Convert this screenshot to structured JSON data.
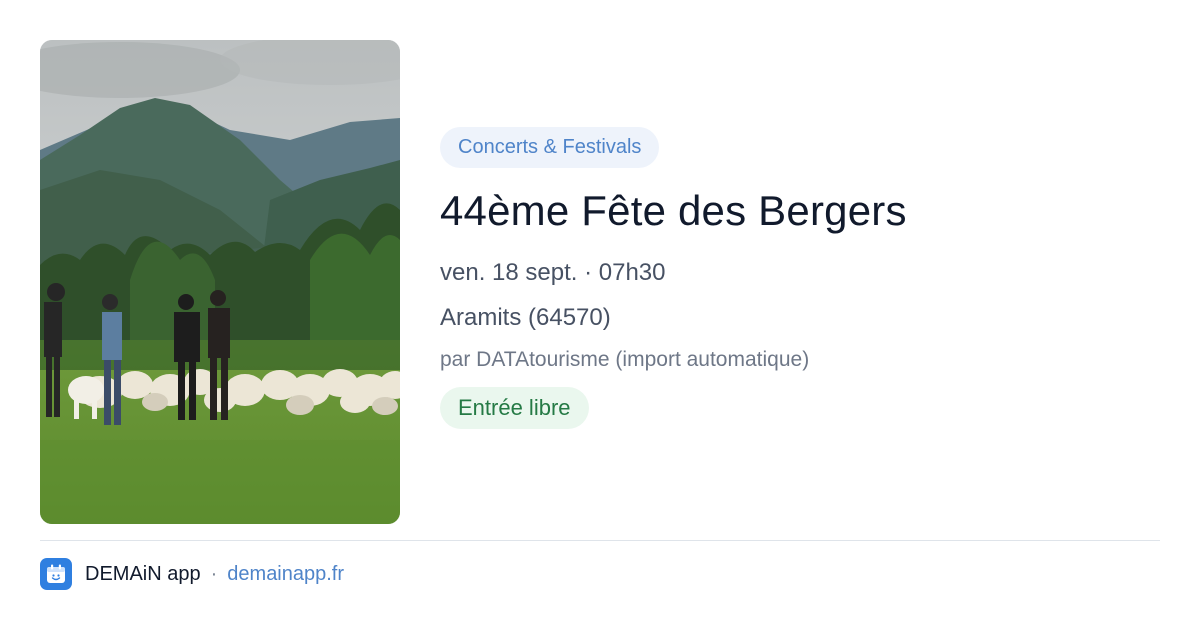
{
  "event": {
    "image_alt": "Bergers et troupeau de moutons dans une prairie au pied des montagnes",
    "category": "Concerts & Festivals",
    "title": "44ème Fête des Bergers",
    "datetime": "ven. 18 sept. · 07h30",
    "location": "Aramits (64570)",
    "organizer": "par DATAtourisme (import automatique)",
    "price": "Entrée libre"
  },
  "footer": {
    "app_name": "DEMAiN app",
    "separator": "·",
    "site": "demainapp.fr",
    "app_icon": "calendar-smiley-icon"
  },
  "colors": {
    "category_text": "#4f84c9",
    "category_bg": "#eef3fb",
    "price_text": "#257a45",
    "price_bg": "#eaf7ee",
    "link": "#4f84c9",
    "app_icon_bg": "#2f7fe0"
  }
}
